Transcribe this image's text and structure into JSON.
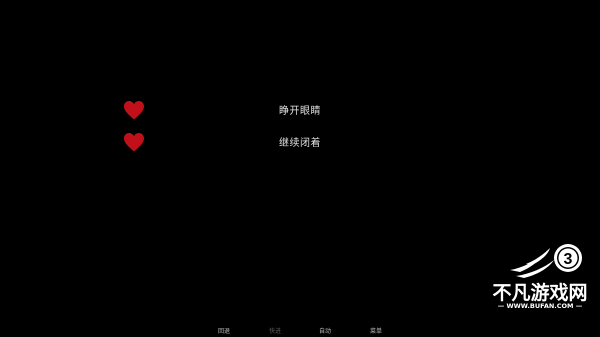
{
  "choices": [
    {
      "label": "睁开眼睛",
      "icon": "heart-icon"
    },
    {
      "label": "继续闭着",
      "icon": "heart-icon"
    }
  ],
  "quick_menu": {
    "back": "回退",
    "skip": "快进",
    "auto": "自动",
    "menu": "菜单"
  },
  "watermark": {
    "badge": "3",
    "name": "不凡游戏网",
    "url": "— WWW.BUFAN.COM —"
  },
  "colors": {
    "background": "#000000",
    "heart": "#c0101a",
    "text": "#e0e0e0",
    "disabled": "#5a5a5a"
  }
}
